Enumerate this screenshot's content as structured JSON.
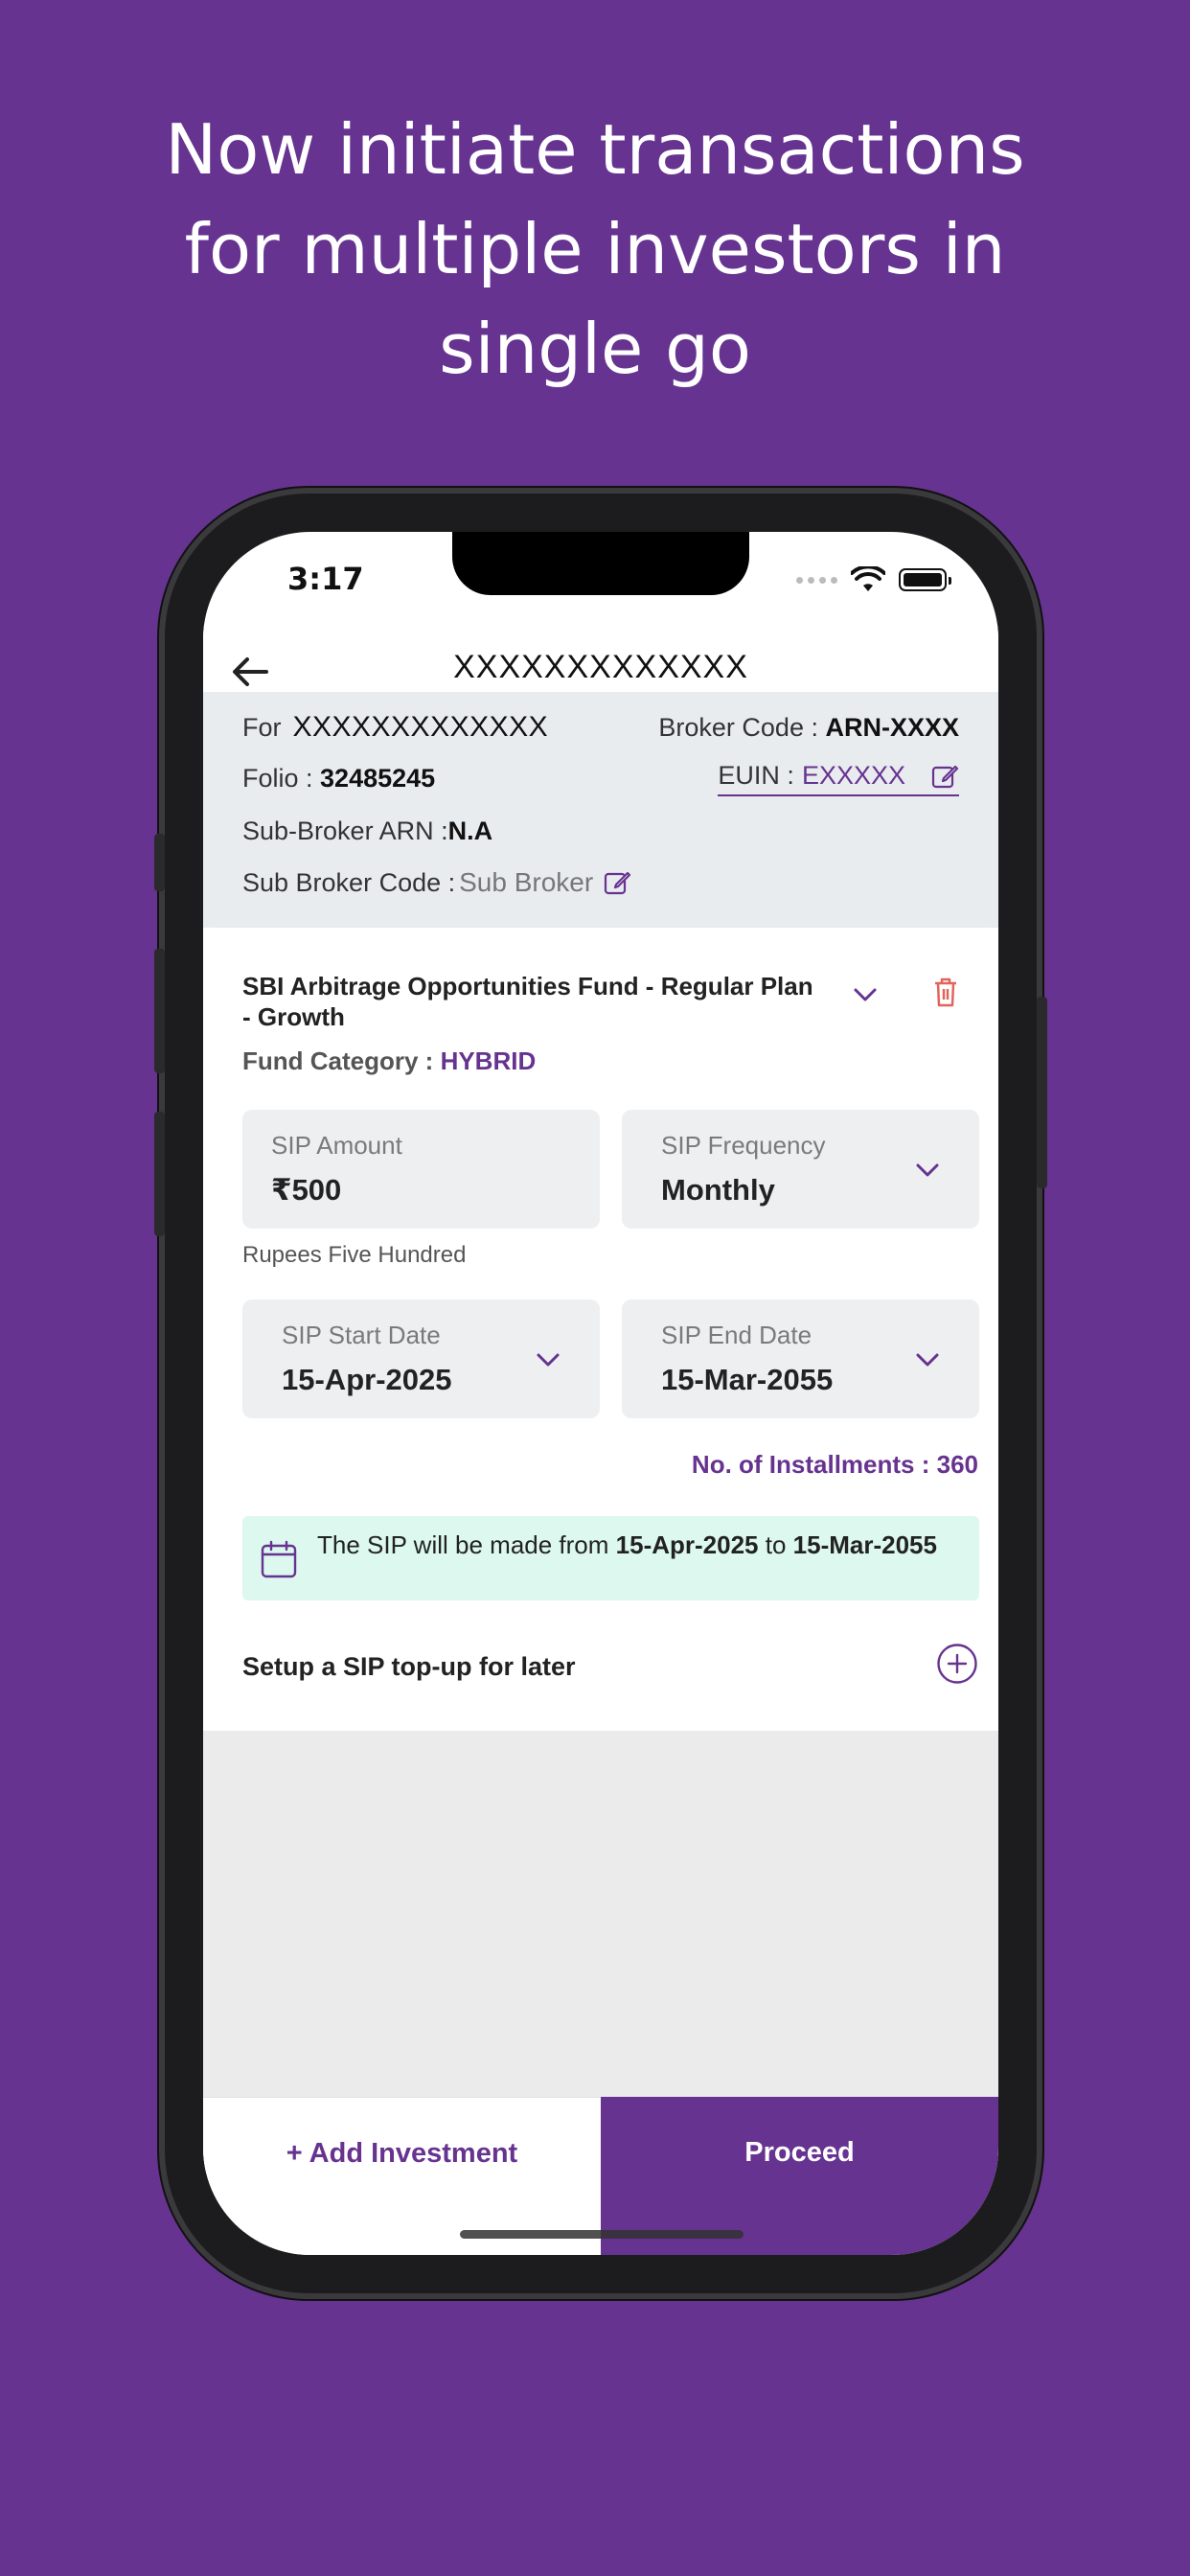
{
  "promo": {
    "line1": "Now initiate transactions",
    "line2": "for multiple investors in",
    "line3": "single go"
  },
  "status_bar": {
    "time": "3:17"
  },
  "header": {
    "title": "XXXXXXXXXXXXX",
    "back_icon": "arrow-left-icon"
  },
  "info": {
    "for_label": "For",
    "for_value": "XXXXXXXXXXXXX",
    "broker_code_label": "Broker Code : ",
    "broker_code_value": "ARN-XXXX",
    "folio_label": "Folio : ",
    "folio_value": "32485245",
    "euin_label": "EUIN : ",
    "euin_value": "EXXXXX",
    "sub_broker_arn_label": "Sub-Broker ARN : ",
    "sub_broker_arn_value": "N.A",
    "sub_broker_code_label": "Sub Broker Code : ",
    "sub_broker_code_placeholder": "Sub Broker"
  },
  "fund": {
    "name": "SBI Arbitrage Opportunities Fund - Regular Plan - Growth",
    "category_label": "Fund Category : ",
    "category_value": "HYBRID"
  },
  "sip": {
    "amount_label": "SIP Amount",
    "amount_value": "₹500",
    "amount_words": "Rupees Five Hundred",
    "frequency_label": "SIP Frequency",
    "frequency_value": "Monthly",
    "start_label": "SIP Start Date",
    "start_value": "15-Apr-2025",
    "end_label": "SIP End Date",
    "end_value": "15-Mar-2055",
    "installments": "No. of Installments : 360"
  },
  "notice": {
    "prefix": "The SIP will be made from ",
    "from": "15-Apr-2025",
    "middle": " to ",
    "to": "15-Mar-2055"
  },
  "topup": {
    "label": "Setup a SIP top-up for later"
  },
  "footer": {
    "add_label": "+ Add Investment",
    "proceed_label": "Proceed"
  },
  "colors": {
    "brand": "#663390",
    "notice_bg": "#dcf8ef",
    "danger": "#e0655a"
  }
}
